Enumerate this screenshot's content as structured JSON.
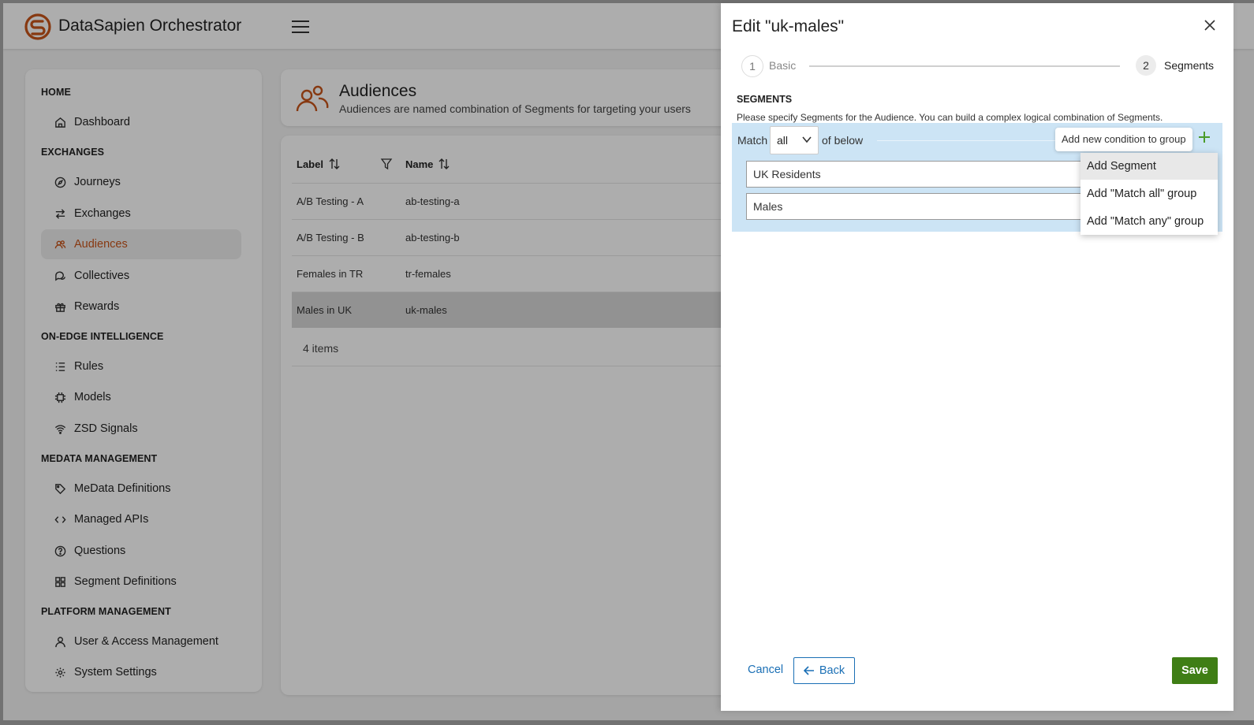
{
  "app": {
    "title": "DataSapien Orchestrator",
    "brand_color": "#c8541a"
  },
  "sidebar": {
    "sections": [
      {
        "title": "HOME",
        "items": [
          {
            "label": "Dashboard",
            "icon": "home-icon"
          }
        ]
      },
      {
        "title": "EXCHANGES",
        "items": [
          {
            "label": "Journeys",
            "icon": "compass-icon"
          },
          {
            "label": "Exchanges",
            "icon": "arrows-swap-icon"
          },
          {
            "label": "Audiences",
            "icon": "people-icon",
            "active": true
          },
          {
            "label": "Collectives",
            "icon": "chat-bubbles-icon"
          },
          {
            "label": "Rewards",
            "icon": "gift-icon"
          }
        ]
      },
      {
        "title": "ON-EDGE INTELLIGENCE",
        "items": [
          {
            "label": "Rules",
            "icon": "list-icon"
          },
          {
            "label": "Models",
            "icon": "chip-icon"
          },
          {
            "label": "ZSD Signals",
            "icon": "wifi-icon"
          }
        ]
      },
      {
        "title": "MEDATA MANAGEMENT",
        "items": [
          {
            "label": "MeData Definitions",
            "icon": "tag-icon"
          },
          {
            "label": "Managed APIs",
            "icon": "code-icon"
          },
          {
            "label": "Questions",
            "icon": "question-icon"
          },
          {
            "label": "Segment Definitions",
            "icon": "grid-icon"
          }
        ]
      },
      {
        "title": "PLATFORM MANAGEMENT",
        "items": [
          {
            "label": "User & Access Management",
            "icon": "user-icon"
          },
          {
            "label": "System Settings",
            "icon": "gear-icon"
          }
        ]
      }
    ]
  },
  "page": {
    "title": "Audiences",
    "subtitle": "Audiences are named combination of Segments for targeting your users"
  },
  "table": {
    "columns": [
      "Label",
      "Name"
    ],
    "rows": [
      {
        "label": "A/B Testing - A",
        "name": "ab-testing-a"
      },
      {
        "label": "A/B Testing - B",
        "name": "ab-testing-b"
      },
      {
        "label": "Females in TR",
        "name": "tr-females"
      },
      {
        "label": "Males in UK",
        "name": "uk-males",
        "selected": true
      }
    ],
    "footer": "4 items"
  },
  "panel": {
    "title": "Edit \"uk-males\"",
    "steps": [
      {
        "number": "1",
        "label": "Basic"
      },
      {
        "number": "2",
        "label": "Segments"
      }
    ],
    "segments_title": "SEGMENTS",
    "segments_desc": "Please specify Segments for the Audience. You can build a complex logical combination of Segments.",
    "match_label": "Match",
    "match_value": "all",
    "of_below": "of below",
    "tooltip": "Add new condition to group",
    "conditions": [
      "UK Residents",
      "Males"
    ],
    "dropdown": [
      "Add Segment",
      "Add \"Match all\" group",
      "Add \"Match any\" group"
    ],
    "cancel": "Cancel",
    "back": "Back",
    "save": "Save"
  }
}
